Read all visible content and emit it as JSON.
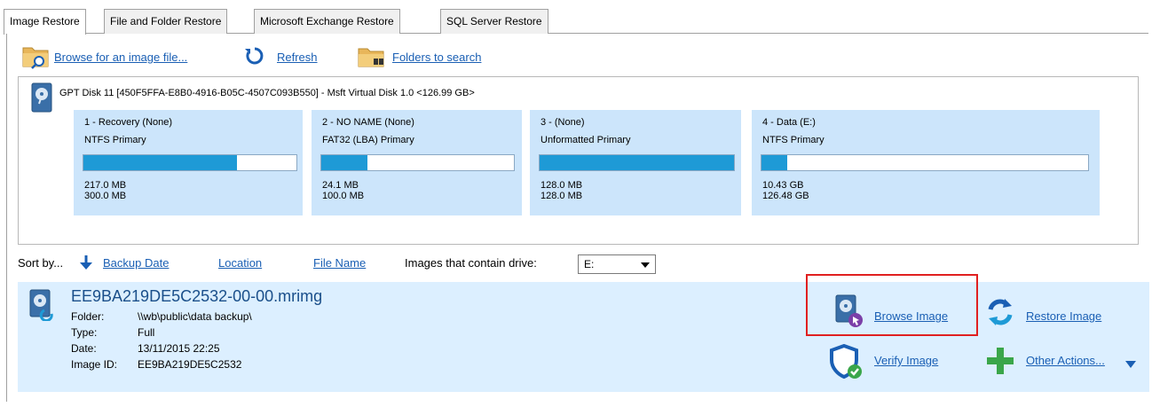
{
  "tabs": [
    {
      "label": "Image Restore",
      "active": true
    },
    {
      "label": "File and Folder Restore",
      "active": false
    },
    {
      "label": "Microsoft Exchange Restore",
      "active": false
    },
    {
      "label": "SQL Server Restore",
      "active": false
    }
  ],
  "toolbar": {
    "browse_label": "Browse for an image file...",
    "refresh_label": "Refresh",
    "folders_label": "Folders to search"
  },
  "disk": {
    "title": "GPT Disk 11 [450F5FFA-E8B0-4916-B05C-4507C093B550] - Msft     Virtual Disk     1.0  <126.99 GB>",
    "partitions": [
      {
        "name": "1 - Recovery (None)",
        "type": "NTFS Primary",
        "used": "217.0 MB",
        "total": "300.0 MB",
        "fill": 0.72
      },
      {
        "name": "2 - NO NAME (None)",
        "type": "FAT32 (LBA) Primary",
        "used": "24.1 MB",
        "total": "100.0 MB",
        "fill": 0.24
      },
      {
        "name": "3 -  (None)",
        "type": "Unformatted Primary",
        "used": "128.0 MB",
        "total": "128.0 MB",
        "fill": 1.0
      },
      {
        "name": "4 - Data (E:)",
        "type": "NTFS Primary",
        "used": "10.43 GB",
        "total": "126.48 GB",
        "fill": 0.08
      }
    ]
  },
  "sort": {
    "label": "Sort by...",
    "backup_date": "Backup Date",
    "location": "Location",
    "file_name": "File Name",
    "drive_label": "Images that contain drive:",
    "drive_value": "E:"
  },
  "entry": {
    "filename": "EE9BA219DE5C2532-00-00.mrimg",
    "folder_key": "Folder:",
    "folder_val": "\\\\wb\\public\\data backup\\",
    "type_key": "Type:",
    "type_val": "Full",
    "date_key": "Date:",
    "date_val": "13/11/2015 22:25",
    "id_key": "Image ID:",
    "id_val": "EE9BA219DE5C2532"
  },
  "actions": {
    "browse_image": "Browse Image",
    "restore_image": "Restore Image",
    "verify_image": "Verify Image",
    "other_actions": "Other Actions..."
  },
  "colors": {
    "link": "#1a5fb4",
    "partition_bg": "#cce5fb",
    "bar_fill": "#1e9ad6",
    "entry_bg": "#dcefff",
    "highlight": "#e02020"
  }
}
